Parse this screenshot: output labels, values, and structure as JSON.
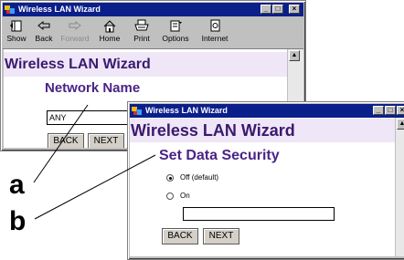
{
  "window1": {
    "title": "Wireless LAN Wizard",
    "controls": [
      "_",
      "□",
      "×"
    ],
    "toolbar": [
      {
        "label": "Show",
        "icon": "show-icon",
        "disabled": false
      },
      {
        "label": "Back",
        "icon": "back-arrow-icon",
        "disabled": false
      },
      {
        "label": "Forward",
        "icon": "forward-arrow-icon",
        "disabled": true
      },
      {
        "label": "Home",
        "icon": "home-icon",
        "disabled": false
      },
      {
        "label": "Print",
        "icon": "print-icon",
        "disabled": false
      },
      {
        "label": "Options",
        "icon": "options-icon",
        "disabled": false
      },
      {
        "label": "Internet",
        "icon": "internet-icon",
        "disabled": false
      }
    ],
    "header": "Wireless LAN Wizard",
    "subheading": "Network Name",
    "network_name_value": "ANY",
    "buttons": {
      "back": "BACK",
      "next": "NEXT"
    }
  },
  "window2": {
    "title": "Wireless LAN Wizard",
    "controls": [
      "_",
      "□",
      "×"
    ],
    "header": "Wireless LAN Wizard",
    "subheading": "Set Data Security",
    "options": [
      {
        "label": "Off (default)",
        "selected": true
      },
      {
        "label": "On",
        "selected": false
      }
    ],
    "key_value": "",
    "buttons": {
      "back": "BACK",
      "next": "NEXT"
    }
  },
  "callouts": {
    "a": "a",
    "b": "b"
  },
  "colors": {
    "titlebar": "#0b1f8a",
    "header_band": "#efe6f7",
    "heading_text": "#4b2387"
  }
}
